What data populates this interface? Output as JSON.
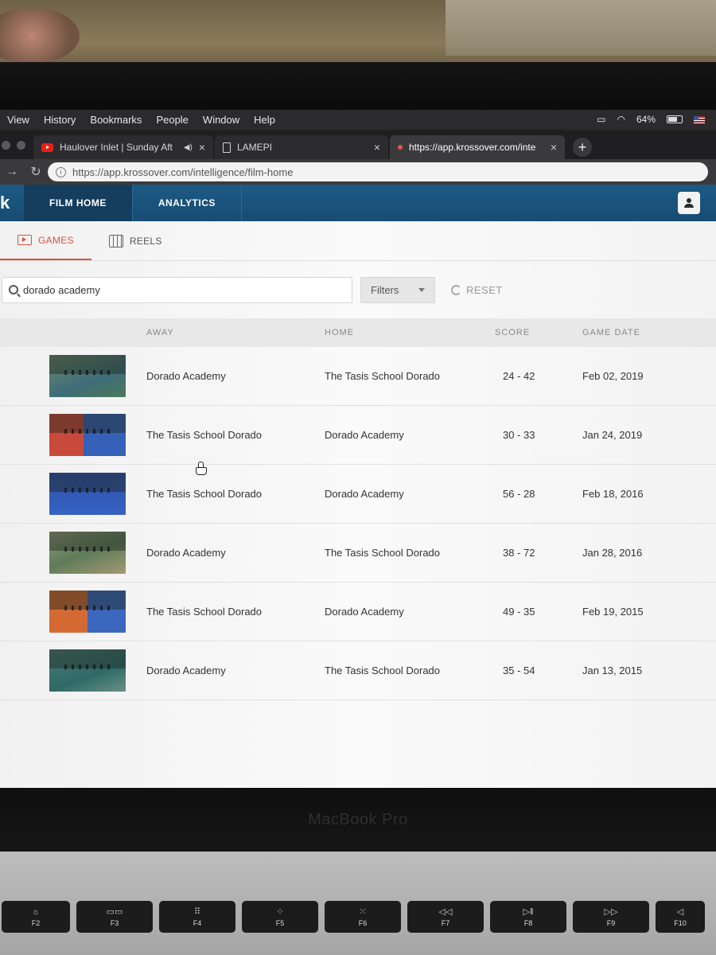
{
  "menubar": {
    "items": [
      "View",
      "History",
      "Bookmarks",
      "People",
      "Window",
      "Help"
    ],
    "battery": "64%"
  },
  "tabs": [
    {
      "title": "Haulover Inlet | Sunday Aft",
      "icon": "youtube-icon",
      "active": false
    },
    {
      "title": "LAMEPI",
      "icon": "document-icon",
      "active": false
    },
    {
      "title": "https://app.krossover.com/inte",
      "icon": "site-icon",
      "active": true
    }
  ],
  "address": {
    "url": "https://app.krossover.com/intelligence/film-home"
  },
  "app": {
    "logo": "k",
    "nav": [
      "FILM HOME",
      "ANALYTICS"
    ],
    "subtabs": [
      "GAMES",
      "REELS"
    ],
    "search_value": "dorado academy",
    "filters_label": "Filters",
    "reset_label": "RESET",
    "columns": {
      "away": "AWAY",
      "home": "HOME",
      "score": "SCORE",
      "date": "GAME DATE"
    },
    "games": [
      {
        "away": "Dorado Academy",
        "home": "The Tasis School Dorado",
        "score": "24 - 42",
        "date": "Feb 02, 2019",
        "thumb": "green"
      },
      {
        "away": "The Tasis School Dorado",
        "home": "Dorado Academy",
        "score": "30 - 33",
        "date": "Jan 24, 2019",
        "thumb": "redblue"
      },
      {
        "away": "The Tasis School Dorado",
        "home": "Dorado Academy",
        "score": "56 - 28",
        "date": "Feb 18, 2016",
        "thumb": "blue"
      },
      {
        "away": "Dorado Academy",
        "home": "The Tasis School Dorado",
        "score": "38 - 72",
        "date": "Jan 28, 2016",
        "thumb": "mixed"
      },
      {
        "away": "The Tasis School Dorado",
        "home": "Dorado Academy",
        "score": "49 - 35",
        "date": "Feb 19, 2015",
        "thumb": "orangeblue"
      },
      {
        "away": "Dorado Academy",
        "home": "The Tasis School Dorado",
        "score": "35 - 54",
        "date": "Jan 13, 2015",
        "thumb": "teal"
      }
    ]
  },
  "laptop": {
    "brand": "MacBook Pro",
    "fkeys": [
      "F2",
      "F3",
      "F4",
      "F5",
      "F6",
      "F7",
      "F8",
      "F9",
      "F10"
    ]
  },
  "colors": {
    "header_blue": "#1d5a86",
    "accent_red": "#d9533d"
  }
}
